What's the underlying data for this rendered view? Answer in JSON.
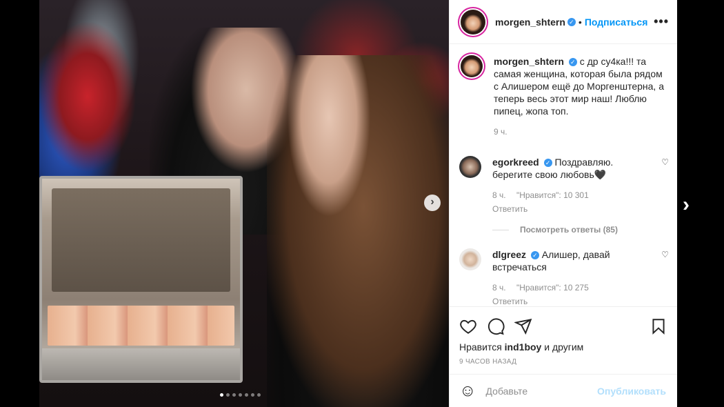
{
  "post": {
    "author": "morgen_shtern",
    "follow_label": "Подписаться",
    "separator": "•",
    "more_label": "•••",
    "caption": "с др су4ка!!! та самая женщина, которая была рядом с Алишером ещё до Моргенштерна, а теперь весь этот мир наш! Люблю пипец, жопа топ.",
    "caption_time": "9 ч."
  },
  "comments": [
    {
      "user": "egorkreed",
      "text": "Поздравляю. берегите свою любовь🖤",
      "time": "8 ч.",
      "likes": "\"Нравится\": 10 301",
      "reply_label": "Ответить",
      "view_replies": "Посмотреть ответы (85)"
    },
    {
      "user": "dlgreez",
      "text": "Алишер, давай встречаться",
      "time": "8 ч.",
      "likes": "\"Нравится\": 10 275",
      "reply_label": "Ответить"
    }
  ],
  "likes_line": {
    "prefix": "Нравится",
    "user": "ind1boy",
    "suffix": "и другим"
  },
  "posted_ago": "9 ЧАСОВ НАЗАД",
  "add_comment": {
    "placeholder": "Добавьте",
    "post_label": "Опубликовать"
  },
  "carousel": {
    "slide_count": 7,
    "active_index": 0
  },
  "colors": {
    "link_blue": "#0095f6",
    "verified_blue": "#3897f0",
    "muted": "#8e8e8e",
    "post_disabled": "#b2dffc"
  },
  "icons": {
    "verified": "✓",
    "carousel_next": "›",
    "modal_next": "›",
    "heart_small": "♡",
    "emoji": "☺"
  }
}
